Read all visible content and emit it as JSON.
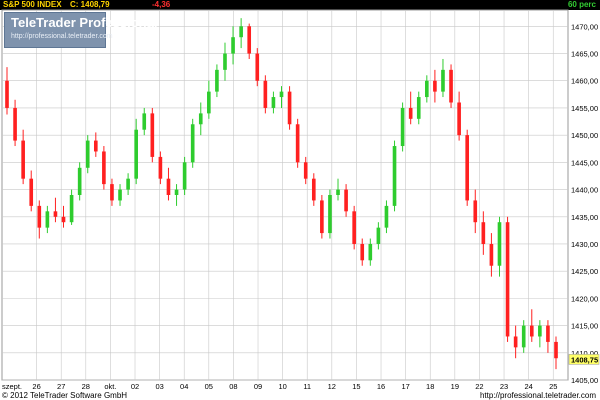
{
  "header": {
    "instrument": "S&P 500 INDEX",
    "last": "C: 1408,79",
    "change": "-4,36",
    "interval": "60 perc"
  },
  "logo": {
    "name": "TeleTrader Professional",
    "url": "http://professional.teletrader.com"
  },
  "footer": {
    "copyright": "© 2012 TeleTrader Software GmbH",
    "url": "http://professional.teletrader.com"
  },
  "colors": {
    "up": "#2ecc2e",
    "down": "#ff2020",
    "grid": "#c8c8c8",
    "last_price_bg": "#ffff66"
  },
  "chart_data": {
    "type": "candlestick",
    "title": "S&P 500 INDEX",
    "interval": "60 perc",
    "ylim": [
      1405,
      1473
    ],
    "y_ticks": [
      "1405,00",
      "1410,00",
      "1415,00",
      "1420,00",
      "1425,00",
      "1430,00",
      "1435,00",
      "1440,00",
      "1445,00",
      "1450,00",
      "1455,00",
      "1460,00",
      "1465,00",
      "1470,00"
    ],
    "x_ticks": [
      "szept.",
      "26",
      "27",
      "28",
      "okt.",
      "02",
      "03",
      "04",
      "05",
      "08",
      "09",
      "10",
      "11",
      "12",
      "15",
      "16",
      "17",
      "18",
      "19",
      "22",
      "23",
      "24",
      "25"
    ],
    "last_price": 1408.79,
    "last_price_label": "1408,75",
    "grid": true,
    "candles": [
      [
        1460,
        1462.5,
        1453.8,
        1455
      ],
      [
        1455,
        1456.5,
        1448,
        1449
      ],
      [
        1449,
        1451,
        1441,
        1442
      ],
      [
        1442,
        1443.5,
        1436,
        1437
      ],
      [
        1437,
        1438,
        1431,
        1433
      ],
      [
        1433,
        1437,
        1432,
        1436
      ],
      [
        1436,
        1438.5,
        1434,
        1435
      ],
      [
        1435,
        1437,
        1433,
        1434
      ],
      [
        1434,
        1440,
        1433.5,
        1439
      ],
      [
        1439,
        1445,
        1438,
        1444
      ],
      [
        1444,
        1450,
        1443,
        1449
      ],
      [
        1449,
        1450.5,
        1446,
        1447
      ],
      [
        1447,
        1448,
        1440,
        1441
      ],
      [
        1441,
        1442,
        1437,
        1438
      ],
      [
        1438,
        1441,
        1437,
        1440
      ],
      [
        1440,
        1443,
        1439,
        1442
      ],
      [
        1442,
        1453,
        1441,
        1451
      ],
      [
        1451,
        1455,
        1450,
        1454
      ],
      [
        1454,
        1455,
        1445,
        1446
      ],
      [
        1446,
        1447,
        1441,
        1442
      ],
      [
        1442,
        1444,
        1438,
        1439
      ],
      [
        1439,
        1441,
        1437,
        1440
      ],
      [
        1440,
        1446,
        1439,
        1445
      ],
      [
        1445,
        1453,
        1444,
        1452
      ],
      [
        1452,
        1456,
        1450,
        1454
      ],
      [
        1454,
        1460,
        1453,
        1458
      ],
      [
        1458,
        1463,
        1457,
        1462
      ],
      [
        1462,
        1467,
        1460,
        1465
      ],
      [
        1465,
        1470,
        1463,
        1468
      ],
      [
        1468,
        1471.5,
        1466,
        1470
      ],
      [
        1470,
        1470.5,
        1464,
        1465
      ],
      [
        1465,
        1466,
        1459,
        1460
      ],
      [
        1460,
        1461,
        1454,
        1455
      ],
      [
        1455,
        1458,
        1454,
        1457
      ],
      [
        1457,
        1459,
        1455,
        1458
      ],
      [
        1458,
        1459,
        1451,
        1452
      ],
      [
        1452,
        1453,
        1444,
        1445
      ],
      [
        1445,
        1446,
        1441,
        1442
      ],
      [
        1442,
        1443,
        1437,
        1438
      ],
      [
        1438,
        1439,
        1431,
        1432
      ],
      [
        1432,
        1440,
        1431,
        1439
      ],
      [
        1439,
        1442,
        1438,
        1440
      ],
      [
        1440,
        1441,
        1435,
        1436
      ],
      [
        1436,
        1437,
        1429,
        1430
      ],
      [
        1430,
        1431,
        1426,
        1427
      ],
      [
        1427,
        1431,
        1426,
        1430
      ],
      [
        1430,
        1434,
        1429,
        1433
      ],
      [
        1433,
        1438,
        1432,
        1437
      ],
      [
        1437,
        1449,
        1436,
        1448
      ],
      [
        1448,
        1456,
        1447,
        1455
      ],
      [
        1455,
        1458,
        1452,
        1453
      ],
      [
        1453,
        1458,
        1452,
        1457
      ],
      [
        1457,
        1461,
        1456,
        1460
      ],
      [
        1460,
        1462,
        1456,
        1458
      ],
      [
        1458,
        1464,
        1457,
        1462
      ],
      [
        1462,
        1463,
        1455,
        1456
      ],
      [
        1456,
        1458,
        1449,
        1450
      ],
      [
        1450,
        1451,
        1437,
        1438
      ],
      [
        1438,
        1440,
        1432,
        1434
      ],
      [
        1434,
        1436,
        1428,
        1430
      ],
      [
        1430,
        1432,
        1424,
        1426
      ],
      [
        1426,
        1435,
        1424,
        1434
      ],
      [
        1434,
        1435,
        1412,
        1413
      ],
      [
        1413,
        1415,
        1409,
        1411
      ],
      [
        1411,
        1416,
        1410,
        1415
      ],
      [
        1415,
        1418,
        1412,
        1413
      ],
      [
        1413,
        1416,
        1411,
        1415
      ],
      [
        1415,
        1416,
        1410,
        1412
      ],
      [
        1412,
        1413,
        1407,
        1409
      ]
    ]
  }
}
